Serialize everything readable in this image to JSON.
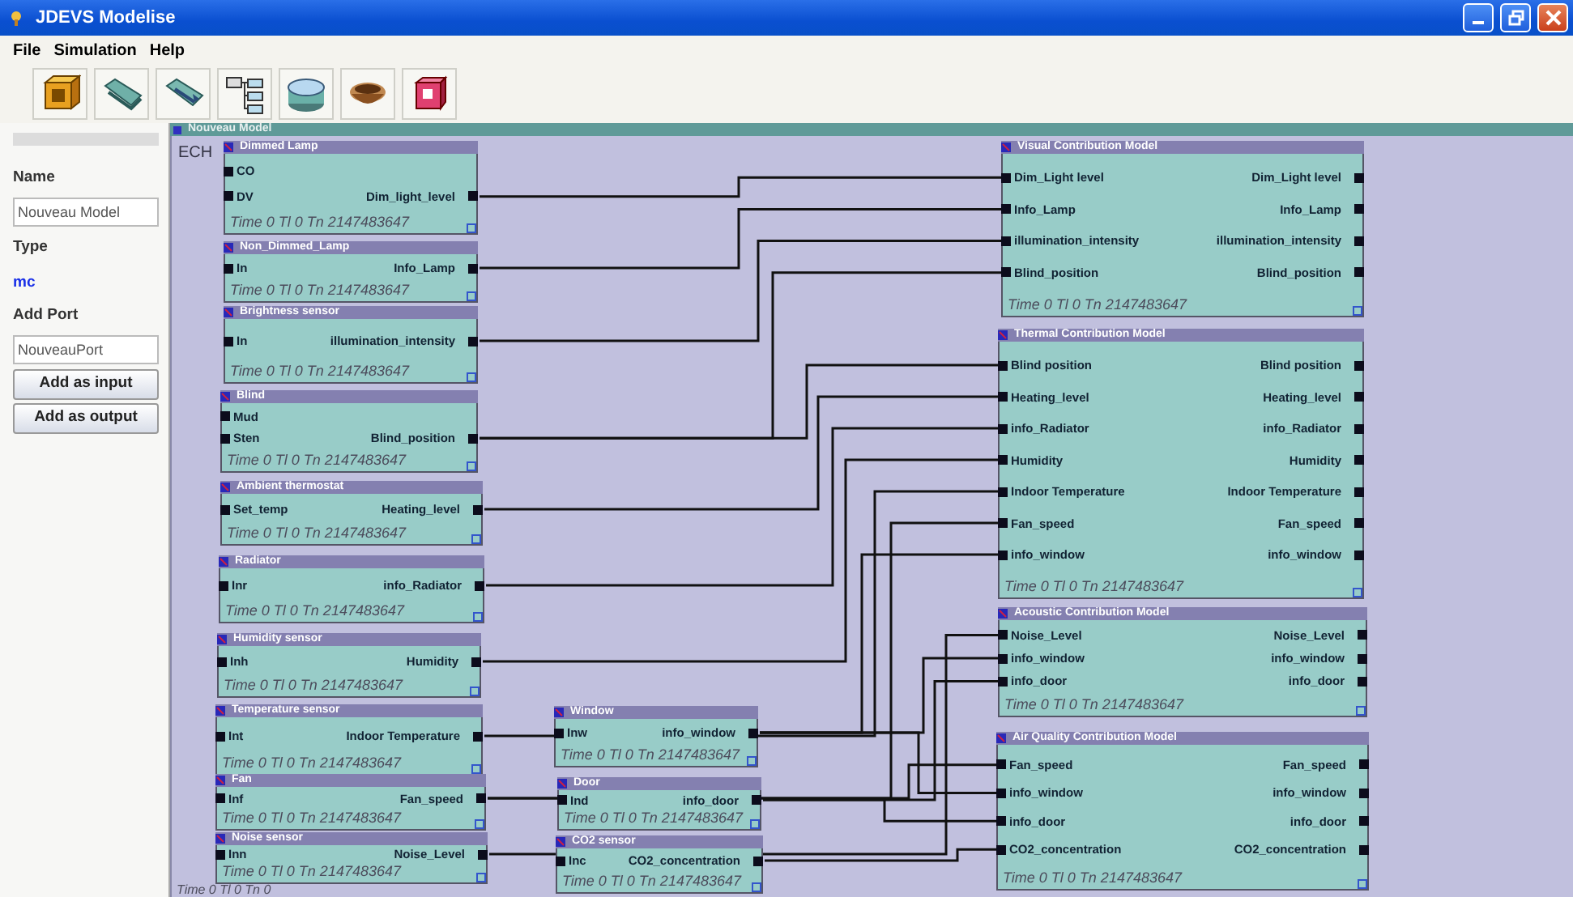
{
  "window": {
    "title": "JDEVS Modelise"
  },
  "menu": [
    "File",
    "Simulation",
    "Help"
  ],
  "sidebar": {
    "name_label": "Name",
    "name_value": "Nouveau Model",
    "type_label": "Type",
    "type_value": "mc",
    "port_label": "Add Port",
    "port_value": "NouveauPort",
    "buttons": [
      "Add as input",
      "Add as output"
    ]
  },
  "model": {
    "title": "Nouveau Model",
    "label": "ECH",
    "time": "Time 0 Tl 0 Tn 0",
    "blocks": [
      {
        "title": "Dimmed Lamp",
        "inputs": [
          "CO",
          "DV"
        ],
        "outputs": [
          "Dim_light_level"
        ],
        "time": "Time 0 Tl 0 Tn 2147483647"
      },
      {
        "title": "Non_Dimmed_Lamp",
        "inputs": [
          "In"
        ],
        "outputs": [
          "Info_Lamp"
        ],
        "time": "Time 0 Tl 0 Tn 2147483647"
      },
      {
        "title": "Brightness sensor",
        "inputs": [
          "In"
        ],
        "outputs": [
          "illumination_intensity"
        ],
        "time": "Time 0 Tl 0 Tn 2147483647"
      },
      {
        "title": "Blind",
        "inputs": [
          "Mud",
          "Sten"
        ],
        "outputs": [
          "Blind_position"
        ],
        "time": "Time 0 Tl 0 Tn 2147483647"
      },
      {
        "title": "Ambient thermostat",
        "inputs": [
          "Set_temp"
        ],
        "outputs": [
          "Heating_level"
        ],
        "time": "Time 0 Tl 0 Tn 2147483647"
      },
      {
        "title": "Radiator",
        "inputs": [
          "Inr"
        ],
        "outputs": [
          "info_Radiator"
        ],
        "time": "Time 0 Tl 0 Tn 2147483647"
      },
      {
        "title": "Humidity sensor",
        "inputs": [
          "Inh"
        ],
        "outputs": [
          "Humidity"
        ],
        "time": "Time 0 Tl 0 Tn 2147483647"
      },
      {
        "title": "Temperature sensor",
        "inputs": [
          "Int"
        ],
        "outputs": [
          "Indoor Temperature"
        ],
        "time": "Time 0 Tl 0 Tn 2147483647"
      },
      {
        "title": "Fan",
        "inputs": [
          "Inf"
        ],
        "outputs": [
          "Fan_speed"
        ],
        "time": "Time 0 Tl 0 Tn 2147483647"
      },
      {
        "title": "Noise sensor",
        "inputs": [
          "Inn"
        ],
        "outputs": [
          "Noise_Level"
        ],
        "time": "Time 0 Tl 0 Tn 2147483647"
      },
      {
        "title": "Window",
        "inputs": [
          "Inw"
        ],
        "outputs": [
          "info_window"
        ],
        "time": "Time 0 Tl 0 Tn 2147483647"
      },
      {
        "title": "Door",
        "inputs": [
          "Ind"
        ],
        "outputs": [
          "info_door"
        ],
        "time": "Time 0 Tl 0 Tn 2147483647"
      },
      {
        "title": "CO2 sensor",
        "inputs": [
          "Inc"
        ],
        "outputs": [
          "CO2_concentration"
        ],
        "time": "Time 0 Tl 0 Tn 2147483647"
      },
      {
        "title": "Visual Contribution Model",
        "inputs": [
          "Dim_Light level",
          "Info_Lamp",
          "illumination_intensity",
          "Blind_position"
        ],
        "outputs": [
          "Dim_Light level",
          "Info_Lamp",
          "illumination_intensity",
          "Blind_position"
        ],
        "time": "Time 0 Tl 0 Tn 2147483647"
      },
      {
        "title": "Thermal Contribution Model",
        "inputs": [
          "Blind position",
          "Heating_level",
          "info_Radiator",
          "Humidity",
          "Indoor Temperature",
          "Fan_speed",
          "info_window"
        ],
        "outputs": [
          "Blind position",
          "Heating_level",
          "info_Radiator",
          "Humidity",
          "Indoor Temperature",
          "Fan_speed",
          "info_window"
        ],
        "time": "Time 0 Tl 0 Tn 2147483647"
      },
      {
        "title": "Acoustic Contribution Model",
        "inputs": [
          "Noise_Level",
          "info_window",
          "info_door"
        ],
        "outputs": [
          "Noise_Level",
          "info_window",
          "info_door"
        ],
        "time": "Time 0 Tl 0 Tn 2147483647"
      },
      {
        "title": "Air Quality Contribution Model",
        "inputs": [
          "Fan_speed",
          "info_window",
          "info_door",
          "CO2_concentration"
        ],
        "outputs": [
          "Fan_speed",
          "info_window",
          "info_door",
          "CO2_concentration"
        ],
        "time": "Time 0 Tl 0 Tn 2147483647"
      }
    ]
  }
}
